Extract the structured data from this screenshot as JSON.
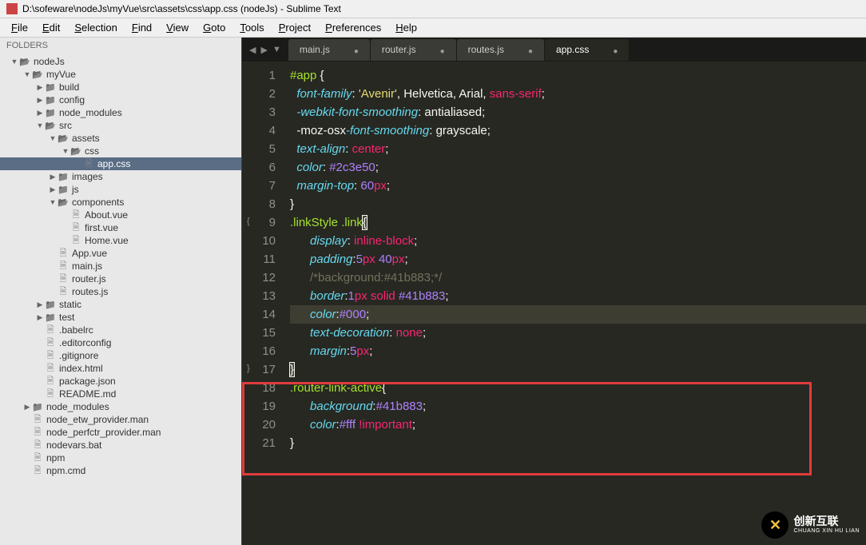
{
  "window": {
    "title": "D:\\sofeware\\nodeJs\\myVue\\src\\assets\\css\\app.css (nodeJs) - Sublime Text"
  },
  "menu": {
    "items": [
      "File",
      "Edit",
      "Selection",
      "Find",
      "View",
      "Goto",
      "Tools",
      "Project",
      "Preferences",
      "Help"
    ]
  },
  "sidebar": {
    "header": "FOLDERS",
    "tree": [
      {
        "depth": 0,
        "type": "folder-open",
        "label": "nodeJs",
        "chev": "▼"
      },
      {
        "depth": 1,
        "type": "folder-open",
        "label": "myVue",
        "chev": "▼"
      },
      {
        "depth": 2,
        "type": "folder",
        "label": "build",
        "chev": "▶"
      },
      {
        "depth": 2,
        "type": "folder",
        "label": "config",
        "chev": "▶"
      },
      {
        "depth": 2,
        "type": "folder",
        "label": "node_modules",
        "chev": "▶"
      },
      {
        "depth": 2,
        "type": "folder-open",
        "label": "src",
        "chev": "▼"
      },
      {
        "depth": 3,
        "type": "folder-open",
        "label": "assets",
        "chev": "▼"
      },
      {
        "depth": 4,
        "type": "folder-open",
        "label": "css",
        "chev": "▼"
      },
      {
        "depth": 5,
        "type": "file",
        "label": "app.css",
        "active": true
      },
      {
        "depth": 3,
        "type": "folder",
        "label": "images",
        "chev": "▶"
      },
      {
        "depth": 3,
        "type": "folder",
        "label": "js",
        "chev": "▶"
      },
      {
        "depth": 3,
        "type": "folder-open",
        "label": "components",
        "chev": "▼"
      },
      {
        "depth": 4,
        "type": "file",
        "label": "About.vue"
      },
      {
        "depth": 4,
        "type": "file",
        "label": "first.vue"
      },
      {
        "depth": 4,
        "type": "file",
        "label": "Home.vue"
      },
      {
        "depth": 3,
        "type": "file",
        "label": "App.vue"
      },
      {
        "depth": 3,
        "type": "file",
        "label": "main.js"
      },
      {
        "depth": 3,
        "type": "file",
        "label": "router.js"
      },
      {
        "depth": 3,
        "type": "file",
        "label": "routes.js"
      },
      {
        "depth": 2,
        "type": "folder",
        "label": "static",
        "chev": "▶"
      },
      {
        "depth": 2,
        "type": "folder",
        "label": "test",
        "chev": "▶"
      },
      {
        "depth": 2,
        "type": "file",
        "label": ".babelrc"
      },
      {
        "depth": 2,
        "type": "file",
        "label": ".editorconfig"
      },
      {
        "depth": 2,
        "type": "file",
        "label": ".gitignore"
      },
      {
        "depth": 2,
        "type": "file",
        "label": "index.html"
      },
      {
        "depth": 2,
        "type": "file",
        "label": "package.json"
      },
      {
        "depth": 2,
        "type": "file",
        "label": "README.md"
      },
      {
        "depth": 1,
        "type": "folder",
        "label": "node_modules",
        "chev": "▶"
      },
      {
        "depth": 1,
        "type": "file",
        "label": "node_etw_provider.man"
      },
      {
        "depth": 1,
        "type": "file",
        "label": "node_perfctr_provider.man"
      },
      {
        "depth": 1,
        "type": "file",
        "label": "nodevars.bat"
      },
      {
        "depth": 1,
        "type": "file",
        "label": "npm"
      },
      {
        "depth": 1,
        "type": "file",
        "label": "npm.cmd"
      }
    ]
  },
  "tabs": [
    {
      "label": "main.js",
      "dirty": true
    },
    {
      "label": "router.js",
      "dirty": true
    },
    {
      "label": "routes.js",
      "dirty": true
    },
    {
      "label": "app.css",
      "dirty": true,
      "active": true
    }
  ],
  "code": {
    "lines": [
      {
        "n": 1,
        "tokens": [
          {
            "t": "#app ",
            "c": "c-sel"
          },
          {
            "t": "{",
            "c": "c-brace"
          }
        ]
      },
      {
        "n": 2,
        "tokens": [
          {
            "t": "  ",
            "c": ""
          },
          {
            "t": "font-family",
            "c": "c-prop"
          },
          {
            "t": ": ",
            "c": "c-white"
          },
          {
            "t": "'Avenir'",
            "c": "c-str"
          },
          {
            "t": ", Helvetica, Arial, ",
            "c": "c-white"
          },
          {
            "t": "sans-serif",
            "c": "c-const"
          },
          {
            "t": ";",
            "c": "c-white"
          }
        ]
      },
      {
        "n": 3,
        "tokens": [
          {
            "t": "  ",
            "c": ""
          },
          {
            "t": "-webkit-font-smoothing",
            "c": "c-prop"
          },
          {
            "t": ": antialiased;",
            "c": "c-white"
          }
        ]
      },
      {
        "n": 4,
        "tokens": [
          {
            "t": "  -moz-",
            "c": "c-white"
          },
          {
            "t": "osx",
            "c": "c-white"
          },
          {
            "t": "-font-smoothing",
            "c": "c-prop"
          },
          {
            "t": ": grayscale;",
            "c": "c-white"
          }
        ]
      },
      {
        "n": 5,
        "tokens": [
          {
            "t": "  ",
            "c": ""
          },
          {
            "t": "text-align",
            "c": "c-prop"
          },
          {
            "t": ": ",
            "c": "c-white"
          },
          {
            "t": "center",
            "c": "c-const"
          },
          {
            "t": ";",
            "c": "c-white"
          }
        ]
      },
      {
        "n": 6,
        "tokens": [
          {
            "t": "  ",
            "c": ""
          },
          {
            "t": "color",
            "c": "c-prop"
          },
          {
            "t": ": ",
            "c": "c-white"
          },
          {
            "t": "#2c3e50",
            "c": "c-num"
          },
          {
            "t": ";",
            "c": "c-white"
          }
        ]
      },
      {
        "n": 7,
        "tokens": [
          {
            "t": "  ",
            "c": ""
          },
          {
            "t": "margin-top",
            "c": "c-prop"
          },
          {
            "t": ": ",
            "c": "c-white"
          },
          {
            "t": "60",
            "c": "c-num"
          },
          {
            "t": "px",
            "c": "c-const"
          },
          {
            "t": ";",
            "c": "c-white"
          }
        ]
      },
      {
        "n": 8,
        "tokens": [
          {
            "t": "}",
            "c": "c-brace"
          }
        ]
      },
      {
        "n": 9,
        "fold": "{",
        "tokens": [
          {
            "t": ".linkStyle .link",
            "c": "c-sel"
          },
          {
            "t": "{",
            "c": "c-brace c-cursor"
          }
        ]
      },
      {
        "n": 10,
        "tokens": [
          {
            "t": "      ",
            "c": ""
          },
          {
            "t": "display",
            "c": "c-prop"
          },
          {
            "t": ": ",
            "c": "c-white"
          },
          {
            "t": "inline-block",
            "c": "c-const"
          },
          {
            "t": ";",
            "c": "c-white"
          }
        ]
      },
      {
        "n": 11,
        "tokens": [
          {
            "t": "      ",
            "c": ""
          },
          {
            "t": "padding",
            "c": "c-prop"
          },
          {
            "t": ":",
            "c": "c-white"
          },
          {
            "t": "5",
            "c": "c-num"
          },
          {
            "t": "px",
            "c": "c-const"
          },
          {
            "t": " ",
            "c": ""
          },
          {
            "t": "40",
            "c": "c-num"
          },
          {
            "t": "px",
            "c": "c-const"
          },
          {
            "t": ";",
            "c": "c-white"
          }
        ]
      },
      {
        "n": 12,
        "tokens": [
          {
            "t": "      ",
            "c": ""
          },
          {
            "t": "/*background:#41b883;*/",
            "c": "c-comment"
          }
        ]
      },
      {
        "n": 13,
        "tokens": [
          {
            "t": "      ",
            "c": ""
          },
          {
            "t": "border",
            "c": "c-prop"
          },
          {
            "t": ":",
            "c": "c-white"
          },
          {
            "t": "1",
            "c": "c-num"
          },
          {
            "t": "px",
            "c": "c-const"
          },
          {
            "t": " ",
            "c": ""
          },
          {
            "t": "solid",
            "c": "c-const"
          },
          {
            "t": " ",
            "c": ""
          },
          {
            "t": "#41b883",
            "c": "c-num"
          },
          {
            "t": ";",
            "c": "c-white"
          }
        ]
      },
      {
        "n": 14,
        "hl": true,
        "tokens": [
          {
            "t": "      ",
            "c": ""
          },
          {
            "t": "color",
            "c": "c-prop"
          },
          {
            "t": ":",
            "c": "c-white"
          },
          {
            "t": "#000",
            "c": "c-num"
          },
          {
            "t": ";",
            "c": "c-white"
          }
        ]
      },
      {
        "n": 15,
        "tokens": [
          {
            "t": "      ",
            "c": ""
          },
          {
            "t": "text-decoration",
            "c": "c-prop"
          },
          {
            "t": ": ",
            "c": "c-white"
          },
          {
            "t": "none",
            "c": "c-const"
          },
          {
            "t": ";",
            "c": "c-white"
          }
        ]
      },
      {
        "n": 16,
        "tokens": [
          {
            "t": "      ",
            "c": ""
          },
          {
            "t": "margin",
            "c": "c-prop"
          },
          {
            "t": ":",
            "c": "c-white"
          },
          {
            "t": "5",
            "c": "c-num"
          },
          {
            "t": "px",
            "c": "c-const"
          },
          {
            "t": ";",
            "c": "c-white"
          }
        ]
      },
      {
        "n": 17,
        "fold": "}",
        "tokens": [
          {
            "t": "}",
            "c": "c-brace c-cursor"
          }
        ]
      },
      {
        "n": 18,
        "tokens": [
          {
            "t": ".router-link-active",
            "c": "c-sel"
          },
          {
            "t": "{",
            "c": "c-brace"
          }
        ]
      },
      {
        "n": 19,
        "tokens": [
          {
            "t": "      ",
            "c": ""
          },
          {
            "t": "background",
            "c": "c-prop"
          },
          {
            "t": ":",
            "c": "c-white"
          },
          {
            "t": "#41b883",
            "c": "c-num"
          },
          {
            "t": ";",
            "c": "c-white"
          }
        ]
      },
      {
        "n": 20,
        "tokens": [
          {
            "t": "      ",
            "c": ""
          },
          {
            "t": "color",
            "c": "c-prop"
          },
          {
            "t": ":",
            "c": "c-white"
          },
          {
            "t": "#fff ",
            "c": "c-num"
          },
          {
            "t": "!important",
            "c": "c-const"
          },
          {
            "t": ";",
            "c": "c-white"
          }
        ]
      },
      {
        "n": 21,
        "tokens": [
          {
            "t": "}",
            "c": "c-brace"
          }
        ]
      }
    ]
  },
  "watermark": {
    "cn": "创新互联",
    "en": "CHUANG XIN HU LIAN"
  }
}
